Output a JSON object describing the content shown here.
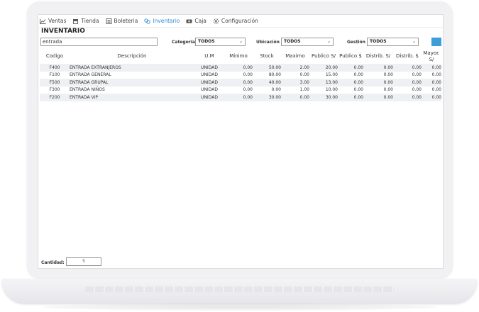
{
  "menu": {
    "items": [
      {
        "label": "Ventas",
        "icon": "chart-line-icon"
      },
      {
        "label": "Tienda",
        "icon": "store-icon"
      },
      {
        "label": "Boleteria",
        "icon": "ticket-icon"
      },
      {
        "label": "Inventario",
        "icon": "boxes-icon",
        "active": true
      },
      {
        "label": "Caja",
        "icon": "cash-icon"
      },
      {
        "label": "Configuración",
        "icon": "gear-icon"
      }
    ]
  },
  "page": {
    "title": "INVENTARIO"
  },
  "search": {
    "value": "entrada"
  },
  "filters": {
    "categoria": {
      "label": "Categoría",
      "value": "TODOS"
    },
    "ubicacion": {
      "label": "Ubicación",
      "value": "TODOS"
    },
    "gestion": {
      "label": "Gestión",
      "value": "TODOS"
    }
  },
  "table": {
    "columns": [
      "Codigo",
      "Descripción",
      "U.M",
      "Minimo",
      "Stock",
      "Maximo",
      "Publico S/",
      "Publico $",
      "Distrib. S/",
      "Distrib. $",
      "Mayor. S/"
    ],
    "rows": [
      [
        "F400",
        "ENTRADA EXTRANJEROS",
        "UNIDAD",
        "0.00",
        "50.00",
        "2.00",
        "20.00",
        "0.00",
        "0.00",
        "0.00",
        "0.00"
      ],
      [
        "F100",
        "ENTRADA GENERAL",
        "UNIDAD",
        "0.00",
        "80.00",
        "0.00",
        "15.00",
        "0.00",
        "0.00",
        "0.00",
        "0.00"
      ],
      [
        "F500",
        "ENTRADA GRUPAL",
        "UNIDAD",
        "0.00",
        "40.00",
        "3.00",
        "13.00",
        "0.00",
        "0.00",
        "0.00",
        "0.00"
      ],
      [
        "F300",
        "ENTRADA NIÑOS",
        "UNIDAD",
        "0.00",
        "0.00",
        "1.00",
        "10.00",
        "0.00",
        "0.00",
        "0.00",
        "0.00"
      ],
      [
        "F200",
        "ENTRADA VIP",
        "UNIDAD",
        "0.00",
        "30.00",
        "0.00",
        "30.00",
        "0.00",
        "0.00",
        "0.00",
        "0.00"
      ]
    ]
  },
  "footer": {
    "cantidad_label": "Cantidad:",
    "cantidad_value": "5"
  },
  "colors": {
    "accent": "#2c8ad6",
    "button": "#3d9ed9",
    "row_stripe": "#eef0f3"
  }
}
